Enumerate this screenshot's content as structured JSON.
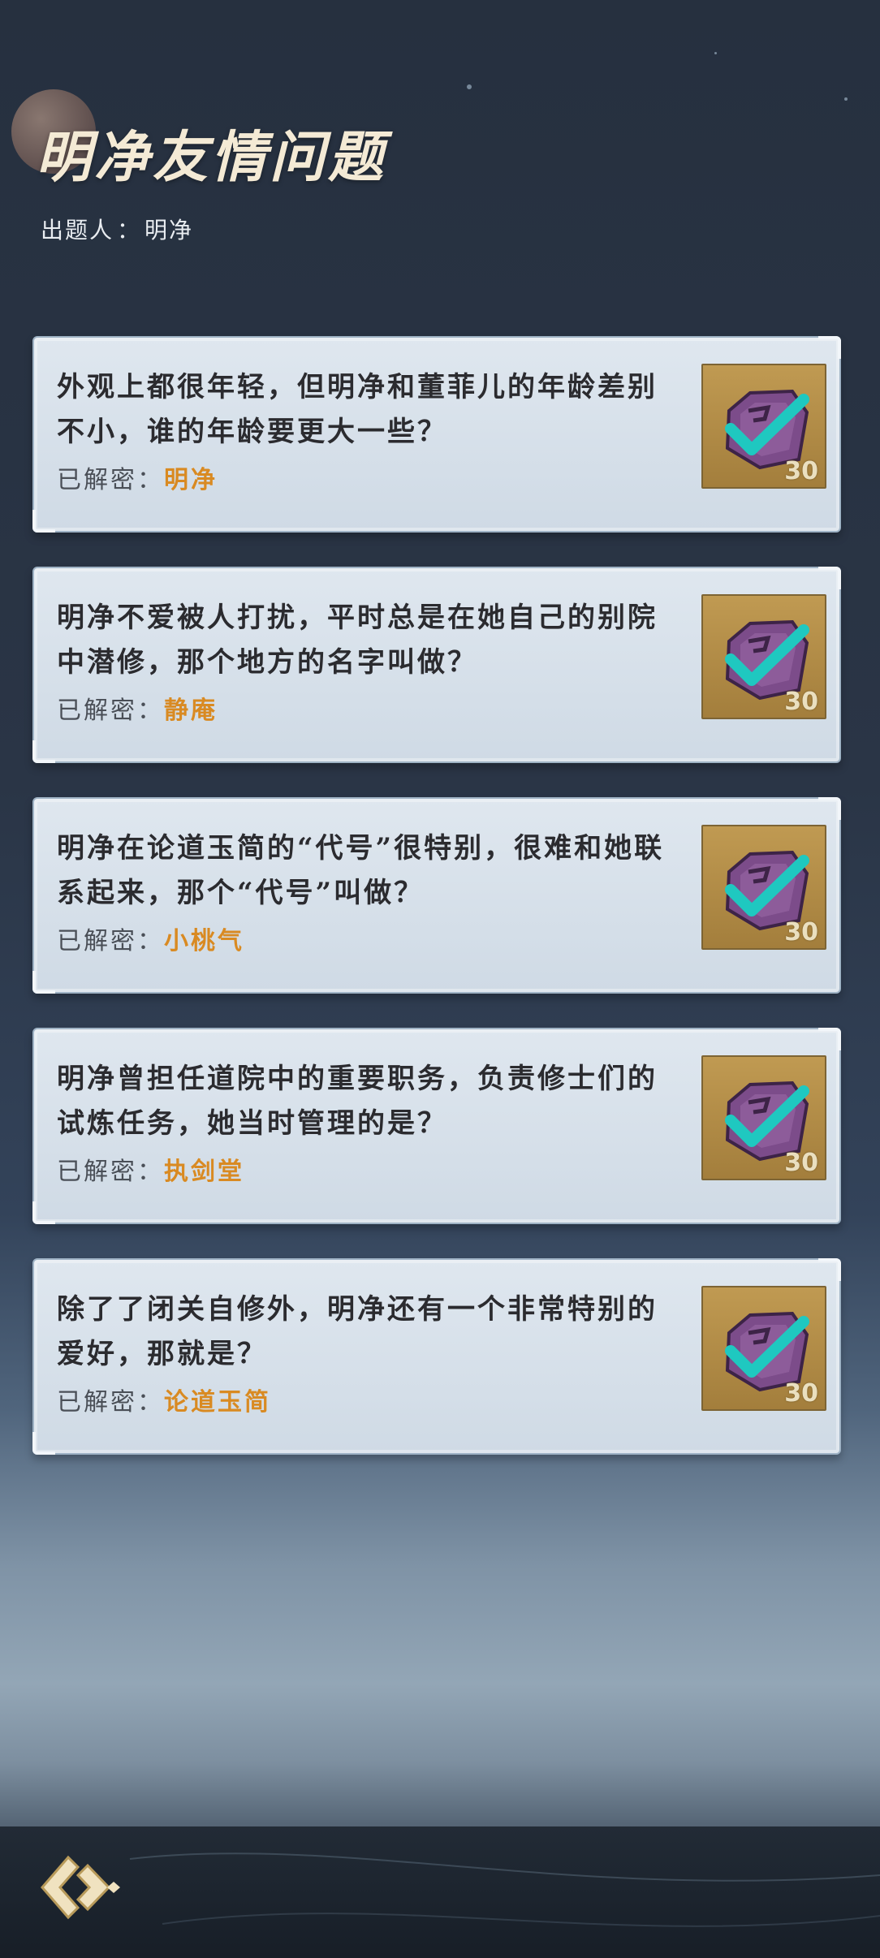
{
  "page": {
    "title": "明净友情问题",
    "author_label": "出题人",
    "author_sep": "：",
    "author_name": "明净"
  },
  "answer_label": "已解密：",
  "reward_points": "30",
  "colors": {
    "answer": "#d98a22",
    "check": "#22c7c0",
    "badge_bg": "#b48e47"
  },
  "icons": {
    "badge": "purple-check-seal-icon",
    "back": "back-arrow-icon"
  },
  "questions": [
    {
      "text": "外观上都很年轻，但明净和董菲儿的年龄差别不小，谁的年龄要更大一些？",
      "answer": "明净"
    },
    {
      "text": "明净不爱被人打扰，平时总是在她自己的别院中潜修，那个地方的名字叫做？",
      "answer": "静庵"
    },
    {
      "text": "明净在论道玉简的“代号”很特别，很难和她联系起来，那个“代号”叫做？",
      "answer": "小桃气"
    },
    {
      "text": "明净曾担任道院中的重要职务，负责修士们的试炼任务，她当时管理的是？",
      "answer": "执剑堂"
    },
    {
      "text": "除了了闭关自修外，明净还有一个非常特别的爱好，那就是？",
      "answer": "论道玉简"
    }
  ]
}
